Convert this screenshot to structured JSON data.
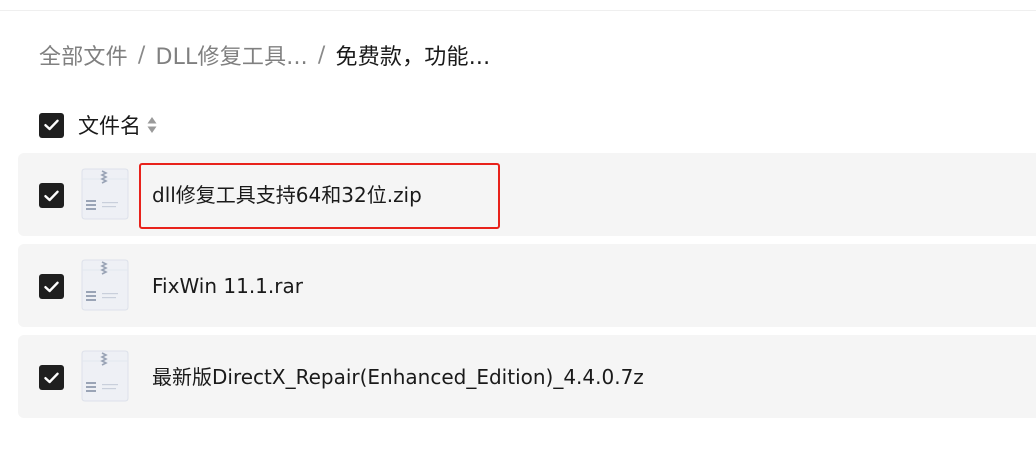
{
  "breadcrumb": {
    "items": [
      "全部文件",
      "DLL修复工具...",
      "免费款，功能..."
    ],
    "separator": "/"
  },
  "header": {
    "column_label": "文件名",
    "select_all_checked": true
  },
  "files": [
    {
      "name": "dll修复工具支持64和32位.zip",
      "checked": true,
      "highlighted": true
    },
    {
      "name": "FixWin 11.1.rar",
      "checked": true,
      "highlighted": false
    },
    {
      "name": "最新版DirectX_Repair(Enhanced_Edition)_4.4.0.7z",
      "checked": true,
      "highlighted": false
    }
  ],
  "icons": {
    "checkbox": "checkmark-icon",
    "sort": "sort-arrows-icon",
    "file": "archive-file-icon"
  },
  "colors": {
    "checkbox_fill": "#1f1f1f",
    "row_background": "#f5f5f5",
    "highlight_border": "#e8221b",
    "breadcrumb_muted": "#808080",
    "text_primary": "#1a1a1a"
  }
}
